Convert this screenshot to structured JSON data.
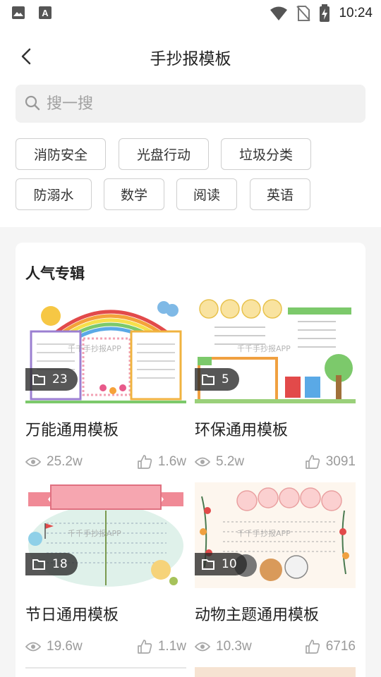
{
  "status_bar": {
    "time": "10:24",
    "left_icons": [
      "image-icon",
      "text-a-icon"
    ],
    "right_icons": [
      "wifi-icon",
      "no-sim-icon",
      "battery-charging-icon"
    ]
  },
  "header": {
    "title": "手抄报模板",
    "back_icon": "chevron-left-icon"
  },
  "search": {
    "placeholder": "搜一搜"
  },
  "tags": [
    "消防安全",
    "光盘行动",
    "垃圾分类",
    "防溺水",
    "数学",
    "阅读",
    "英语"
  ],
  "section": {
    "title": "人气专辑"
  },
  "albums": [
    {
      "title": "万能通用模板",
      "count": "23",
      "views": "25.2w",
      "likes": "1.6w",
      "watermark": "千千手抄报APP"
    },
    {
      "title": "环保通用模板",
      "count": "5",
      "views": "5.2w",
      "likes": "3091",
      "watermark": "千千手抄报APP"
    },
    {
      "title": "节日通用模板",
      "count": "18",
      "views": "19.6w",
      "likes": "1.1w",
      "watermark": "千千手抄报APP"
    },
    {
      "title": "动物主题通用模板",
      "count": "10",
      "views": "10.3w",
      "likes": "6716",
      "watermark": "千千手抄报APP"
    }
  ],
  "colors": {
    "page_bg": "#f5f5f5",
    "search_bg": "#f1f1f1",
    "text_primary": "#222222",
    "text_muted": "#9a9a9a"
  }
}
